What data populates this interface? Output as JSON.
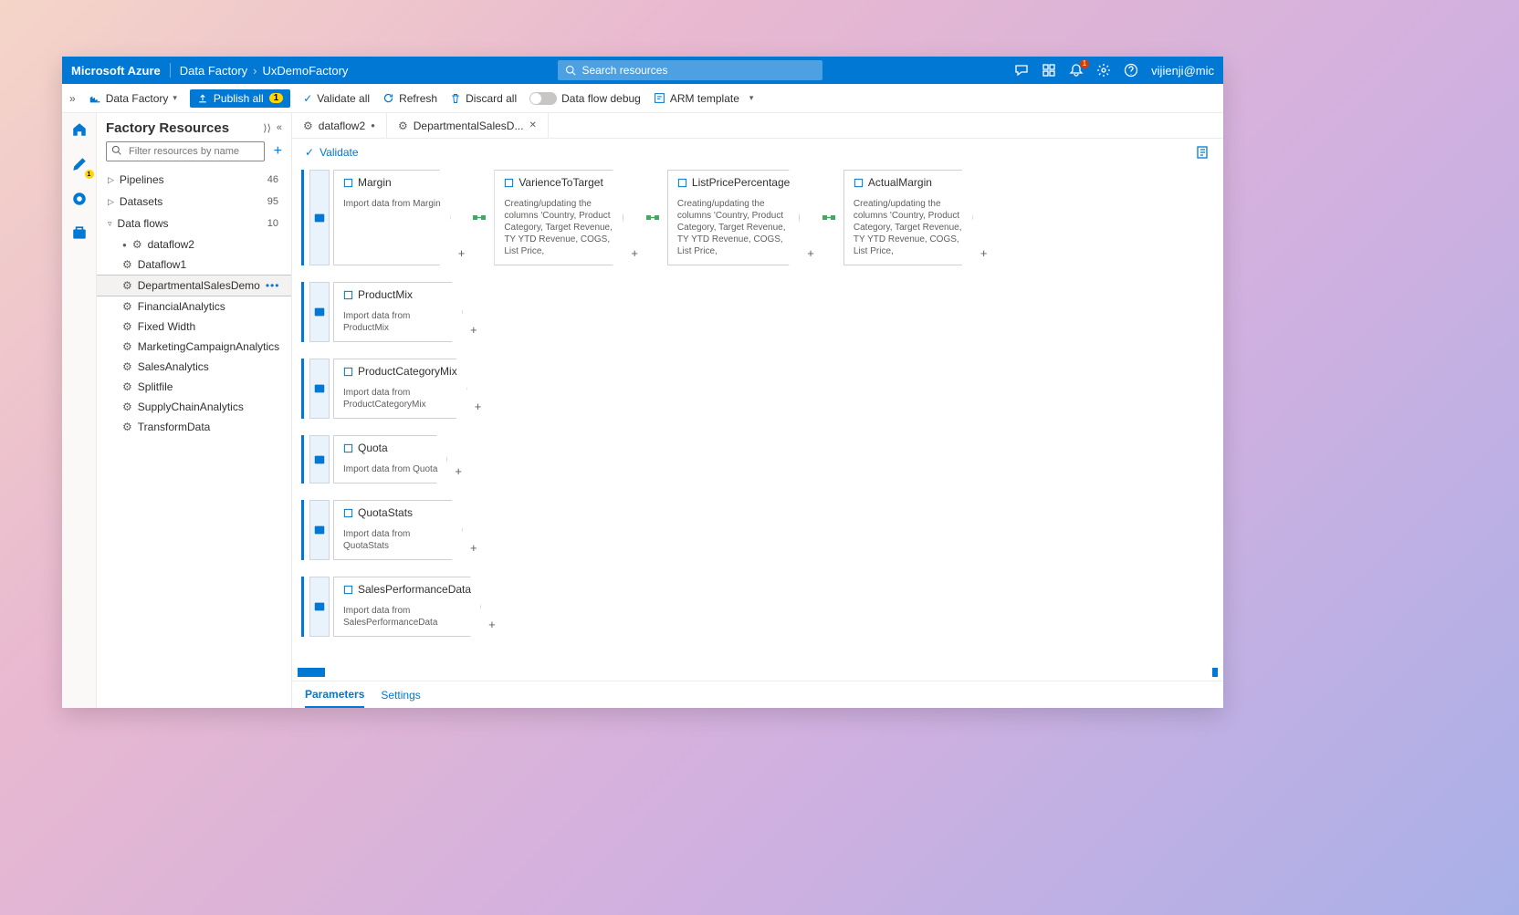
{
  "azure": {
    "brand": "Microsoft Azure",
    "breadcrumb1": "Data Factory",
    "breadcrumb2": "UxDemoFactory",
    "search_placeholder": "Search resources",
    "notification_count": "1",
    "user": "vijienji@mic"
  },
  "toolbar": {
    "data_factory": "Data Factory",
    "publish": "Publish all",
    "publish_count": "1",
    "validate_all": "Validate all",
    "refresh": "Refresh",
    "discard": "Discard all",
    "debug": "Data flow debug",
    "arm": "ARM template"
  },
  "rail": {
    "pencil_badge": "1"
  },
  "resources": {
    "title": "Factory Resources",
    "filter_placeholder": "Filter resources by name",
    "groups": {
      "pipelines": {
        "label": "Pipelines",
        "count": "46"
      },
      "datasets": {
        "label": "Datasets",
        "count": "95"
      },
      "dataflows": {
        "label": "Data flows",
        "count": "10"
      }
    },
    "flows": [
      {
        "name": "dataflow2",
        "dirty": true
      },
      {
        "name": "Dataflow1"
      },
      {
        "name": "DepartmentalSalesDemo",
        "selected": true
      },
      {
        "name": "FinancialAnalytics"
      },
      {
        "name": "Fixed Width"
      },
      {
        "name": "MarketingCampaignAnalytics"
      },
      {
        "name": "SalesAnalytics"
      },
      {
        "name": "Splitfile"
      },
      {
        "name": "SupplyChainAnalytics"
      },
      {
        "name": "TransformData"
      }
    ]
  },
  "tabs": {
    "t1": "dataflow2",
    "t2": "DepartmentalSalesD..."
  },
  "subtoolbar": {
    "validate": "Validate"
  },
  "canvas": {
    "rows": [
      {
        "nodes": [
          {
            "title": "Margin",
            "desc": "Import data from Margin"
          },
          {
            "title": "VarienceToTarget",
            "desc": "Creating/updating the columns 'Country, Product Category, Target Revenue, TY YTD Revenue, COGS, List Price,"
          },
          {
            "title": "ListPricePercentage",
            "desc": "Creating/updating the columns 'Country, Product Category, Target Revenue, TY YTD Revenue, COGS, List Price,"
          },
          {
            "title": "ActualMargin",
            "desc": "Creating/updating the columns 'Country, Product Category, Target Revenue, TY YTD Revenue, COGS, List Price,"
          }
        ]
      },
      {
        "nodes": [
          {
            "title": "ProductMix",
            "desc": "Import data from ProductMix"
          }
        ]
      },
      {
        "nodes": [
          {
            "title": "ProductCategoryMix",
            "desc": "Import data from ProductCategoryMix"
          }
        ]
      },
      {
        "nodes": [
          {
            "title": "Quota",
            "desc": "Import data from Quota"
          }
        ]
      },
      {
        "nodes": [
          {
            "title": "QuotaStats",
            "desc": "Import data from QuotaStats"
          }
        ]
      },
      {
        "nodes": [
          {
            "title": "SalesPerformanceData",
            "desc": "Import data from SalesPerformanceData"
          }
        ]
      }
    ]
  },
  "bottom": {
    "parameters": "Parameters",
    "settings": "Settings"
  }
}
